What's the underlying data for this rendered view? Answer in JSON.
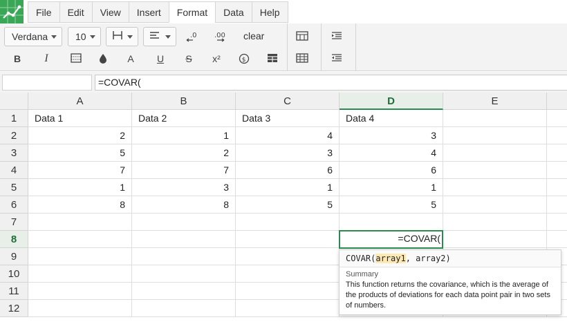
{
  "app": {
    "accent_color": "#3aa757",
    "logo_icon": "spreadsheet-logo-icon"
  },
  "menu": {
    "items": [
      "File",
      "Edit",
      "View",
      "Insert",
      "Format",
      "Data",
      "Help"
    ],
    "active": "Format"
  },
  "toolbar": {
    "font_family": "Verdana",
    "font_size": "10",
    "clear_label": "clear",
    "icons": [
      "borders-icon",
      "align-icon",
      "decrease-decimals-icon",
      "increase-decimals-icon",
      "bold-icon",
      "italic-icon",
      "pattern-icon",
      "fill-color-icon",
      "font-color-icon",
      "underline-icon",
      "strikethrough-icon",
      "superscript-icon",
      "currency-icon",
      "table-icon",
      "merge-cells-icon",
      "wrap-cells-icon",
      "indent-icon",
      "outdent-icon"
    ],
    "bold_label": "B",
    "italic_label": "I",
    "font_color_label": "A",
    "underline_label": "U",
    "strike_label": "S",
    "superscript_label": "x²"
  },
  "formula_bar": {
    "name_box": "",
    "value": "=COVAR("
  },
  "sheet": {
    "columns": [
      "A",
      "B",
      "C",
      "D",
      "E"
    ],
    "active_column": "D",
    "rows": [
      "1",
      "2",
      "3",
      "4",
      "5",
      "6",
      "7",
      "8",
      "9",
      "10",
      "11",
      "12"
    ],
    "active_row": "8",
    "header_row": [
      "Data 1",
      "Data 2",
      "Data 3",
      "Data 4"
    ],
    "data": [
      [
        "2",
        "1",
        "4",
        "3"
      ],
      [
        "5",
        "2",
        "3",
        "4"
      ],
      [
        "7",
        "7",
        "6",
        "6"
      ],
      [
        "1",
        "3",
        "1",
        "1"
      ],
      [
        "8",
        "8",
        "5",
        "5"
      ]
    ],
    "editing_cell_value": "=COVAR("
  },
  "tooltip": {
    "signature_fn": "COVAR(",
    "signature_arg1": "array1",
    "signature_rest": ", array2)",
    "summary_label": "Summary",
    "description": "This function returns the covariance, which is the average of the products of deviations for each data point pair in two sets of numbers."
  }
}
